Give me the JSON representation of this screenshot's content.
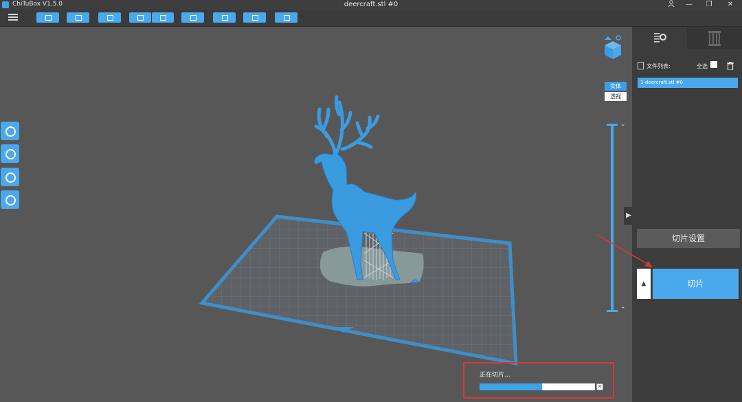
{
  "app": {
    "title": "ChiTuBox V1.5.0",
    "document": "deercraft.stl #0"
  },
  "window_controls": [
    "user-icon",
    "minimize-icon",
    "restore-icon",
    "close-icon"
  ],
  "toolbar": {
    "icons": [
      "open-file-icon",
      "save-icon",
      "export-icon",
      "undo-icon",
      "redo-icon",
      "copy-icon",
      "support-icon",
      "hollow-icon",
      "settings-icon"
    ]
  },
  "left_tools": [
    "move-icon",
    "rotate-icon",
    "scale-icon",
    "mirror-icon"
  ],
  "view": {
    "solid_label": "实体",
    "transparent_label": "透视"
  },
  "progress": {
    "label": "正在切片...",
    "fraction": 0.54
  },
  "sidebar": {
    "tabs": [
      "model-settings-icon",
      "printer-icon"
    ],
    "file_list_label": "文件列表:",
    "select_all_label": "全选",
    "files": [
      "1-deercraft.stl #0"
    ],
    "slice_settings_label": "切片设置",
    "slice_label": "切片"
  },
  "colors": {
    "accent": "#4aa8ec",
    "model": "#3b9be0",
    "highlight": "#d53a35"
  }
}
